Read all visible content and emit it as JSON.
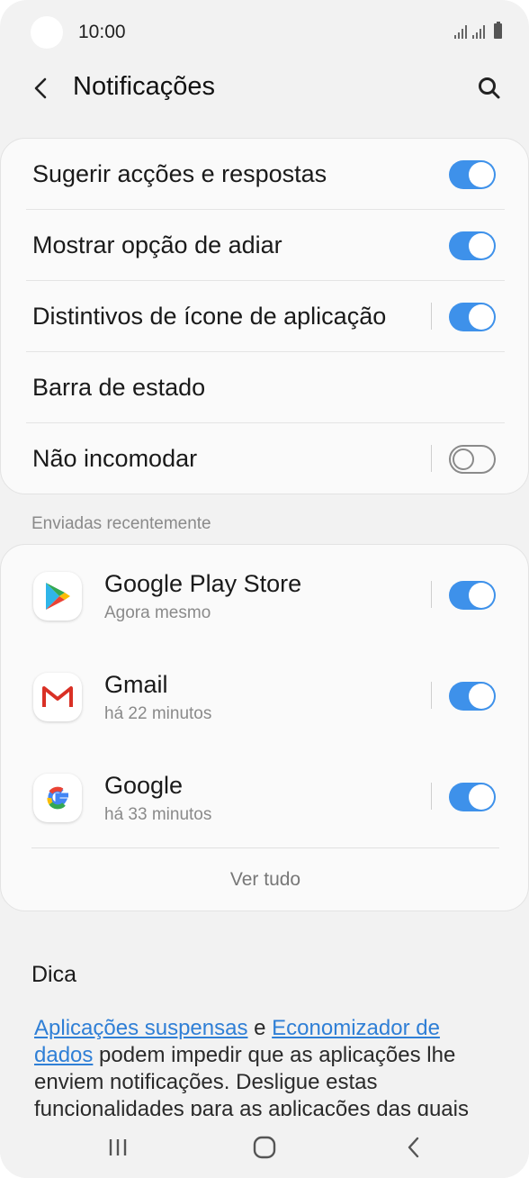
{
  "status_bar": {
    "time": "10:00"
  },
  "header": {
    "title": "Notificações"
  },
  "settings": [
    {
      "label": "Sugerir acções e respostas",
      "toggle": "on"
    },
    {
      "label": "Mostrar opção de adiar",
      "toggle": "on"
    },
    {
      "label": "Distintivos de ícone de aplicação",
      "toggle": "on"
    },
    {
      "label": "Barra de estado"
    },
    {
      "label": "Não incomodar",
      "toggle": "off"
    }
  ],
  "recent": {
    "header": "Enviadas recentemente",
    "apps": [
      {
        "name": "Google Play Store",
        "time": "Agora mesmo",
        "icon": "play-store-icon",
        "toggle": "on"
      },
      {
        "name": "Gmail",
        "time": "há 22 minutos",
        "icon": "gmail-icon",
        "toggle": "on"
      },
      {
        "name": "Google",
        "time": "há 33 minutos",
        "icon": "google-icon",
        "toggle": "on"
      }
    ],
    "see_all": "Ver tudo"
  },
  "tip": {
    "title": "Dica",
    "link1": "Aplicações suspensas",
    "connector": " e ",
    "link2": "Economizador de dados",
    "text": " podem impedir que as aplicações lhe enviem notificações. Desligue estas funcionalidades para as aplicações das quais"
  },
  "colors": {
    "accent": "#3e91ea",
    "link": "#2f7fd6",
    "background": "#f2f2f2",
    "card": "#fafafa"
  }
}
